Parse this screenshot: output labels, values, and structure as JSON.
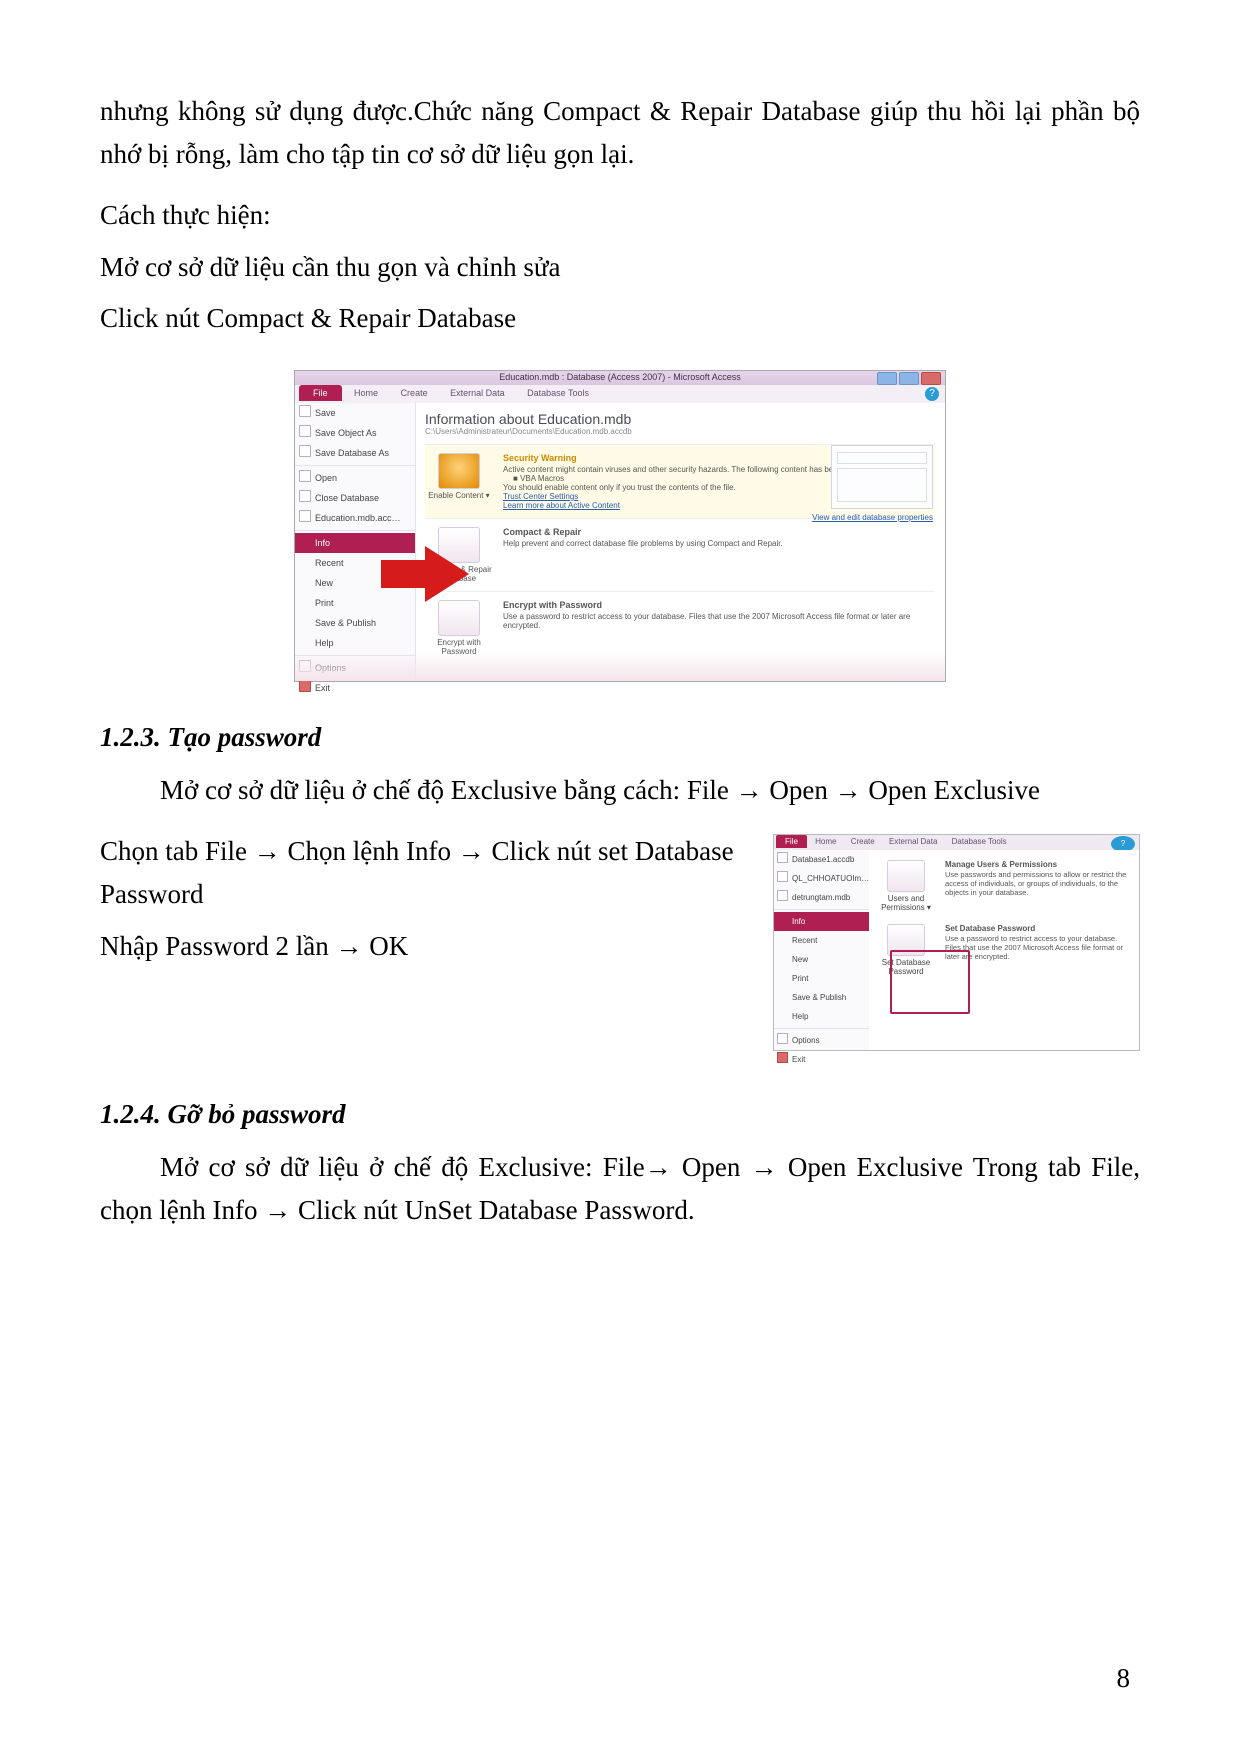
{
  "p_intro": "nhưng không sử dụng được.Chức năng Compact & Repair Database giúp thu hồi lại phần bộ nhớ bị rỗng, làm cho tập tin cơ sở dữ liệu gọn lại.",
  "p_howto": "Cách thực hiện:",
  "p_step1": "Mở cơ sở dữ liệu cần thu gọn và chỉnh sửa",
  "p_step2": "Click nút Compact & Repair Database",
  "shot1": {
    "title": "Education.mdb : Database (Access 2007) - Microsoft Access",
    "tabs": {
      "file": "File",
      "home": "Home",
      "create": "Create",
      "ext": "External Data",
      "dbt": "Database Tools"
    },
    "side": {
      "save": "Save",
      "saveobj": "Save Object As",
      "savedb": "Save Database As",
      "open": "Open",
      "close": "Close Database",
      "recentfile": "Education.mdb.acc…",
      "info": "Info",
      "recent": "Recent",
      "new": "New",
      "print": "Print",
      "savepub": "Save & Publish",
      "help": "Help",
      "options": "Options",
      "exit": "Exit"
    },
    "info_h": "Information about Education.mdb",
    "info_path": "C:\\Users\\Administrateur\\Documents\\Education.mdb.accdb",
    "enable_btn": "Enable Content ▾",
    "sw_h": "Security Warning",
    "sw_l1": "Active content might contain viruses and other security hazards. The following content has been disabled:",
    "sw_l2": "VBA Macros",
    "sw_l3": "You should enable content only if you trust the contents of the file.",
    "sw_link1": "Trust Center Settings",
    "sw_link2": "Learn more about Active Content",
    "cr_btn": "Compact & Repair Database",
    "cr_h": "Compact & Repair",
    "cr_d": "Help prevent and correct database file problems by using Compact and Repair.",
    "ep_btn": "Encrypt with Password",
    "ep_h": "Encrypt with Password",
    "ep_d": "Use a password to restrict access to your database. Files that use the 2007 Microsoft Access file format or later are encrypted.",
    "view_props": "View and edit database properties"
  },
  "h123": "1.2.3. Tạo password",
  "p123a": "Mở cơ sở dữ liệu ở chế độ Exclusive bằng cách: File → Open →  Open Exclusive",
  "p123b": "Chọn tab File →  Chọn lệnh Info → Click nút set Database Password",
  "p123c": "Nhập Password 2 lần → OK",
  "shot2": {
    "tabs": {
      "file": "File",
      "home": "Home",
      "create": "Create",
      "ext": "External Data",
      "dbt": "Database Tools"
    },
    "side": {
      "f1": "Database1.accdb",
      "f2": "QL_CHHOATUOIm…",
      "f3": "detrungtam.mdb",
      "info": "Info",
      "recent": "Recent",
      "new": "New",
      "print": "Print",
      "savepub": "Save & Publish",
      "help": "Help",
      "options": "Options",
      "exit": "Exit"
    },
    "up_btn": "Users and Permissions ▾",
    "up_h": "Manage Users & Permissions",
    "up_d": "Use passwords and permissions to allow or restrict the access of individuals, or groups of individuals, to the objects in your database.",
    "sp_btn": "Set Database Password",
    "sp_h": "Set Database Password",
    "sp_d": "Use a password to restrict access to your database. Files that use the 2007 Microsoft Access file format or later are encrypted."
  },
  "h124": "1.2.4. Gỡ bỏ password",
  "p124a": "Mở cơ sở dữ liệu ở chế độ Exclusive: File→  Open → Open Exclusive Trong tab File, chọn lệnh Info → Click nút UnSet Database Password.",
  "pagenum": "8"
}
